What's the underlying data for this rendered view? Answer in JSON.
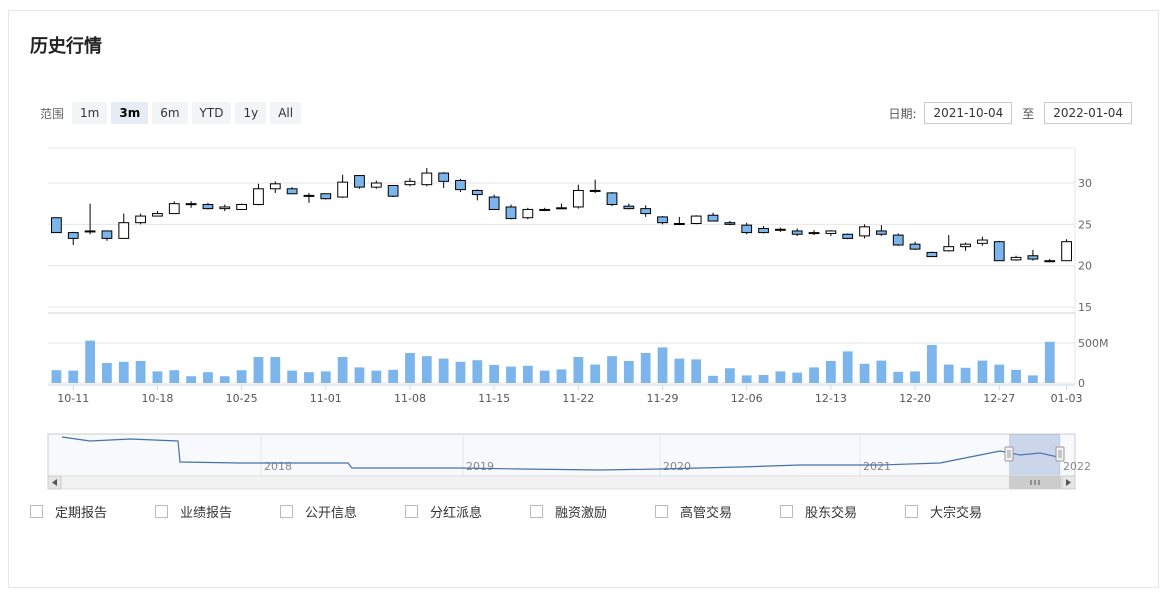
{
  "title": "历史行情",
  "range": {
    "label": "范围",
    "buttons": [
      "1m",
      "3m",
      "6m",
      "YTD",
      "1y",
      "All"
    ],
    "active": "3m"
  },
  "dates": {
    "label": "日期:",
    "from": "2021-10-04",
    "to_label": "至",
    "to": "2022-01-04"
  },
  "filters": [
    "定期报告",
    "业绩报告",
    "公开信息",
    "分红派息",
    "融资激励",
    "高管交易",
    "股东交易",
    "大宗交易"
  ],
  "colors": {
    "up": "#ffffff",
    "down": "#7cb5ec",
    "stroke": "#000000",
    "volume": "#7cb5ec",
    "navigator_line": "#4572a7"
  },
  "chart_data": {
    "type": "candlestick",
    "price_axis": {
      "ticks": [
        15,
        20,
        25,
        30
      ],
      "ylim": [
        10,
        34
      ]
    },
    "volume_axis": {
      "ticks": [
        "0",
        "500M"
      ],
      "tick_values": [
        0,
        500
      ]
    },
    "x_tick_labels": [
      "10-11",
      "10-18",
      "10-25",
      "11-01",
      "11-08",
      "11-15",
      "11-22",
      "11-29",
      "12-06",
      "12-13",
      "12-20",
      "12-27",
      "01-03"
    ],
    "x_tick_index": [
      1,
      6,
      11,
      16,
      21,
      26,
      31,
      36,
      41,
      46,
      51,
      56,
      60
    ],
    "ohlc": [
      [
        25.8,
        25.8,
        24.0,
        24.0
      ],
      [
        24.0,
        24.1,
        22.5,
        23.3
      ],
      [
        24.1,
        27.5,
        23.8,
        24.2
      ],
      [
        24.2,
        24.2,
        23.0,
        23.3
      ],
      [
        23.3,
        26.3,
        23.3,
        25.2
      ],
      [
        25.2,
        26.3,
        25.0,
        26.0
      ],
      [
        26.0,
        26.6,
        26.0,
        26.3
      ],
      [
        26.3,
        27.8,
        26.3,
        27.5
      ],
      [
        27.5,
        27.8,
        27.0,
        27.4
      ],
      [
        27.4,
        27.6,
        26.8,
        26.9
      ],
      [
        26.9,
        27.4,
        26.6,
        27.1
      ],
      [
        26.8,
        27.5,
        26.8,
        27.4
      ],
      [
        27.4,
        29.9,
        27.3,
        29.3
      ],
      [
        29.3,
        30.2,
        28.8,
        29.9
      ],
      [
        29.3,
        29.5,
        28.7,
        28.7
      ],
      [
        28.5,
        28.8,
        27.6,
        28.5
      ],
      [
        28.7,
        28.7,
        28.0,
        28.1
      ],
      [
        28.3,
        31.0,
        28.2,
        30.1
      ],
      [
        30.9,
        30.9,
        29.3,
        29.5
      ],
      [
        29.5,
        30.3,
        29.3,
        30.0
      ],
      [
        29.7,
        29.7,
        28.3,
        28.4
      ],
      [
        29.8,
        30.6,
        29.6,
        30.2
      ],
      [
        29.8,
        31.8,
        29.6,
        31.2
      ],
      [
        31.2,
        31.3,
        29.4,
        30.2
      ],
      [
        30.3,
        30.5,
        28.9,
        29.2
      ],
      [
        29.1,
        29.2,
        27.9,
        28.6
      ],
      [
        28.3,
        28.6,
        26.8,
        26.8
      ],
      [
        27.1,
        27.4,
        25.6,
        25.7
      ],
      [
        25.8,
        27.0,
        25.6,
        26.8
      ],
      [
        26.7,
        27.0,
        26.6,
        26.8
      ],
      [
        26.9,
        27.5,
        26.9,
        27.0
      ],
      [
        27.1,
        29.8,
        26.9,
        29.1
      ],
      [
        29.1,
        30.4,
        28.8,
        29.0
      ],
      [
        28.8,
        28.9,
        27.2,
        27.4
      ],
      [
        27.2,
        27.5,
        26.8,
        26.9
      ],
      [
        26.9,
        27.3,
        25.9,
        26.3
      ],
      [
        25.9,
        26.0,
        25.0,
        25.2
      ],
      [
        25.1,
        25.9,
        24.9,
        25.1
      ],
      [
        25.1,
        26.1,
        25.0,
        26.0
      ],
      [
        26.1,
        26.4,
        25.4,
        25.4
      ],
      [
        25.2,
        25.4,
        24.9,
        25.0
      ],
      [
        24.9,
        25.2,
        23.8,
        24.0
      ],
      [
        24.5,
        24.8,
        23.9,
        24.0
      ],
      [
        24.4,
        24.6,
        24.1,
        24.3
      ],
      [
        24.2,
        24.5,
        23.6,
        23.8
      ],
      [
        24.0,
        24.3,
        23.7,
        23.9
      ],
      [
        23.9,
        24.3,
        23.6,
        24.2
      ],
      [
        23.8,
        23.9,
        23.2,
        23.3
      ],
      [
        23.6,
        25.0,
        23.3,
        24.7
      ],
      [
        24.2,
        24.9,
        23.6,
        23.8
      ],
      [
        23.7,
        23.9,
        22.4,
        22.5
      ],
      [
        22.6,
        22.9,
        21.9,
        22.0
      ],
      [
        21.6,
        21.7,
        21.1,
        21.1
      ],
      [
        21.8,
        23.7,
        21.7,
        22.3
      ],
      [
        22.3,
        22.8,
        21.8,
        22.6
      ],
      [
        22.7,
        23.5,
        22.4,
        23.1
      ],
      [
        22.9,
        23.0,
        20.6,
        20.6
      ],
      [
        20.7,
        21.2,
        20.6,
        21.0
      ],
      [
        21.2,
        21.9,
        20.6,
        20.8
      ],
      [
        20.6,
        20.8,
        20.4,
        20.5
      ],
      [
        20.6,
        23.2,
        20.6,
        22.9
      ]
    ],
    "volume_M": [
      160,
      155,
      530,
      250,
      265,
      275,
      145,
      160,
      85,
      135,
      85,
      160,
      325,
      325,
      155,
      135,
      145,
      325,
      195,
      155,
      165,
      375,
      335,
      305,
      265,
      285,
      225,
      205,
      215,
      155,
      170,
      325,
      230,
      335,
      275,
      375,
      445,
      305,
      295,
      90,
      185,
      95,
      100,
      145,
      130,
      195,
      275,
      395,
      240,
      280,
      140,
      145,
      475,
      230,
      190,
      280,
      230,
      165,
      95,
      515
    ]
  },
  "navigator": {
    "year_labels": [
      "2018",
      "2019",
      "2020",
      "2021",
      "2022"
    ]
  }
}
